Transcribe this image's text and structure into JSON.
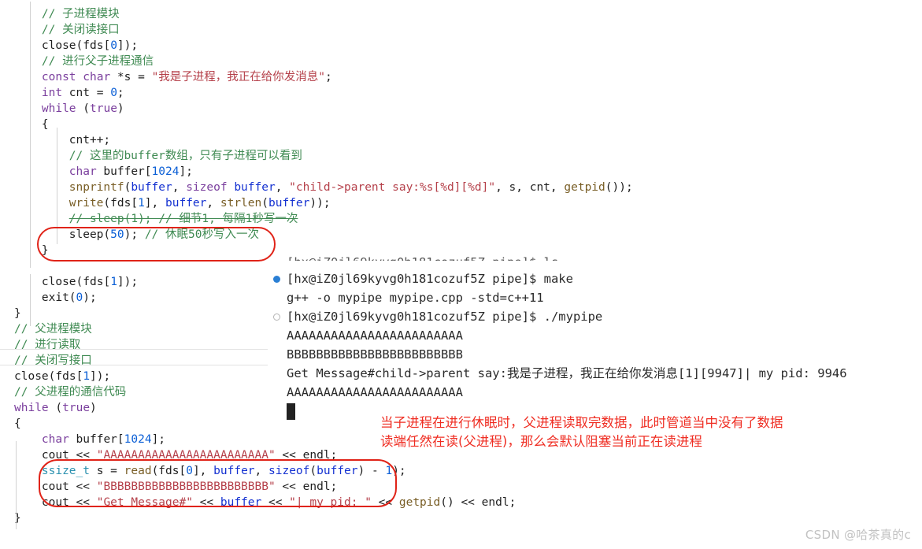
{
  "meta": {
    "watermark": "CSDN @哈茶真的c"
  },
  "colors": {
    "keyword": "#7a3e9d",
    "string": "#b5404a",
    "comment": "#3f8a52",
    "number": "#0b5fd6",
    "function": "#795e26",
    "variable": "#1431d1",
    "type": "#2b91af",
    "annotation_red": "#ef2d22",
    "bullet_active": "#2a7fd4",
    "background": "#ffffff"
  },
  "code": {
    "lines": [
      {
        "indent": 4,
        "tokens": [
          {
            "t": "// 子进程模块",
            "c": "cmt"
          }
        ]
      },
      {
        "indent": 4,
        "tokens": [
          {
            "t": "// 关闭读接口",
            "c": "cmt"
          }
        ]
      },
      {
        "indent": 4,
        "tokens": [
          {
            "t": "close",
            "c": "plain"
          },
          {
            "t": "(fds[",
            "c": "punc"
          },
          {
            "t": "0",
            "c": "num"
          },
          {
            "t": "]);",
            "c": "punc"
          }
        ]
      },
      {
        "indent": 4,
        "tokens": [
          {
            "t": "// 进行父子进程通信",
            "c": "cmt"
          }
        ]
      },
      {
        "indent": 4,
        "tokens": [
          {
            "t": "const",
            "c": "kw"
          },
          {
            "t": " ",
            "c": "plain"
          },
          {
            "t": "char",
            "c": "kw"
          },
          {
            "t": " *s = ",
            "c": "plain"
          },
          {
            "t": "\"我是子进程，我正在给你发消息\"",
            "c": "str"
          },
          {
            "t": ";",
            "c": "punc"
          }
        ]
      },
      {
        "indent": 4,
        "tokens": [
          {
            "t": "int",
            "c": "kw"
          },
          {
            "t": " cnt = ",
            "c": "plain"
          },
          {
            "t": "0",
            "c": "num"
          },
          {
            "t": ";",
            "c": "punc"
          }
        ]
      },
      {
        "indent": 4,
        "tokens": [
          {
            "t": "while",
            "c": "kw"
          },
          {
            "t": " (",
            "c": "punc"
          },
          {
            "t": "true",
            "c": "kw"
          },
          {
            "t": ")",
            "c": "punc"
          }
        ]
      },
      {
        "indent": 4,
        "tokens": [
          {
            "t": "{",
            "c": "punc"
          }
        ]
      },
      {
        "indent": 8,
        "tokens": [
          {
            "t": "cnt++;",
            "c": "plain"
          }
        ]
      },
      {
        "indent": 8,
        "tokens": [
          {
            "t": "// 这里的buffer数组，只有子进程可以看到",
            "c": "cmt"
          }
        ]
      },
      {
        "indent": 8,
        "tokens": [
          {
            "t": "char",
            "c": "kw"
          },
          {
            "t": " buffer[",
            "c": "plain"
          },
          {
            "t": "1024",
            "c": "num"
          },
          {
            "t": "];",
            "c": "punc"
          }
        ]
      },
      {
        "indent": 8,
        "tokens": [
          {
            "t": "snprintf",
            "c": "fn"
          },
          {
            "t": "(",
            "c": "punc"
          },
          {
            "t": "buffer",
            "c": "var"
          },
          {
            "t": ", ",
            "c": "punc"
          },
          {
            "t": "sizeof",
            "c": "kw"
          },
          {
            "t": " ",
            "c": "plain"
          },
          {
            "t": "buffer",
            "c": "var"
          },
          {
            "t": ", ",
            "c": "punc"
          },
          {
            "t": "\"child->parent say:%s[%d][%d]\"",
            "c": "str"
          },
          {
            "t": ", s, cnt, ",
            "c": "punc"
          },
          {
            "t": "getpid",
            "c": "fn"
          },
          {
            "t": "());",
            "c": "punc"
          }
        ]
      },
      {
        "indent": 8,
        "tokens": [
          {
            "t": "write",
            "c": "fn"
          },
          {
            "t": "(fds[",
            "c": "punc"
          },
          {
            "t": "1",
            "c": "num"
          },
          {
            "t": "], ",
            "c": "punc"
          },
          {
            "t": "buffer",
            "c": "var"
          },
          {
            "t": ", ",
            "c": "punc"
          },
          {
            "t": "strlen",
            "c": "fn"
          },
          {
            "t": "(",
            "c": "punc"
          },
          {
            "t": "buffer",
            "c": "var"
          },
          {
            "t": "));",
            "c": "punc"
          }
        ]
      },
      {
        "indent": 8,
        "strike": true,
        "tokens": [
          {
            "t": "// sleep(1); // 细节1, 每隔1秒写一次",
            "c": "cmt"
          }
        ]
      },
      {
        "indent": 8,
        "tokens": [
          {
            "t": "sleep",
            "c": "plain"
          },
          {
            "t": "(",
            "c": "punc"
          },
          {
            "t": "50",
            "c": "num"
          },
          {
            "t": "); ",
            "c": "punc"
          },
          {
            "t": "// 休眠50秒写入一次",
            "c": "cmt"
          }
        ]
      },
      {
        "indent": 4,
        "tokens": [
          {
            "t": "}",
            "c": "punc"
          }
        ]
      },
      {
        "indent": 4,
        "tokens": [
          {
            "t": "",
            "c": "plain"
          }
        ]
      },
      {
        "indent": 4,
        "tokens": [
          {
            "t": "close",
            "c": "plain"
          },
          {
            "t": "(fds[",
            "c": "punc"
          },
          {
            "t": "1",
            "c": "num"
          },
          {
            "t": "]);",
            "c": "punc"
          }
        ]
      },
      {
        "indent": 4,
        "tokens": [
          {
            "t": "exit",
            "c": "plain"
          },
          {
            "t": "(",
            "c": "punc"
          },
          {
            "t": "0",
            "c": "num"
          },
          {
            "t": ");",
            "c": "punc"
          }
        ]
      },
      {
        "indent": 0,
        "tokens": [
          {
            "t": "}",
            "c": "punc"
          }
        ]
      },
      {
        "indent": 0,
        "tokens": [
          {
            "t": "// 父进程模块",
            "c": "cmt"
          }
        ]
      },
      {
        "indent": 0,
        "tokens": [
          {
            "t": "// 进行读取",
            "c": "cmt"
          }
        ]
      },
      {
        "indent": 0,
        "tokens": [
          {
            "t": "// 关闭写接口",
            "c": "cmt"
          }
        ]
      },
      {
        "indent": 0,
        "tokens": [
          {
            "t": "close",
            "c": "plain"
          },
          {
            "t": "(fds[",
            "c": "punc"
          },
          {
            "t": "1",
            "c": "num"
          },
          {
            "t": "]);",
            "c": "punc"
          }
        ]
      },
      {
        "indent": 0,
        "tokens": [
          {
            "t": "// 父进程的通信代码",
            "c": "cmt"
          }
        ]
      },
      {
        "indent": 0,
        "tokens": [
          {
            "t": "while",
            "c": "kw"
          },
          {
            "t": " (",
            "c": "punc"
          },
          {
            "t": "true",
            "c": "kw"
          },
          {
            "t": ")",
            "c": "punc"
          }
        ]
      },
      {
        "indent": 0,
        "tokens": [
          {
            "t": "{",
            "c": "punc"
          }
        ]
      },
      {
        "indent": 4,
        "tokens": [
          {
            "t": "char",
            "c": "kw"
          },
          {
            "t": " buffer[",
            "c": "plain"
          },
          {
            "t": "1024",
            "c": "num"
          },
          {
            "t": "];",
            "c": "punc"
          }
        ]
      },
      {
        "indent": 4,
        "tokens": [
          {
            "t": "cout",
            "c": "plain"
          },
          {
            "t": " << ",
            "c": "punc"
          },
          {
            "t": "\"AAAAAAAAAAAAAAAAAAAAAAAA\"",
            "c": "str"
          },
          {
            "t": " << ",
            "c": "punc"
          },
          {
            "t": "endl",
            "c": "plain"
          },
          {
            "t": ";",
            "c": "punc"
          }
        ]
      },
      {
        "indent": 4,
        "tokens": [
          {
            "t": "ssize_t",
            "c": "type"
          },
          {
            "t": " s = ",
            "c": "plain"
          },
          {
            "t": "read",
            "c": "fn"
          },
          {
            "t": "(fds[",
            "c": "punc"
          },
          {
            "t": "0",
            "c": "num"
          },
          {
            "t": "], ",
            "c": "punc"
          },
          {
            "t": "buffer",
            "c": "var"
          },
          {
            "t": ", ",
            "c": "punc"
          },
          {
            "t": "sizeof",
            "c": "kw2"
          },
          {
            "t": "(",
            "c": "punc"
          },
          {
            "t": "buffer",
            "c": "var"
          },
          {
            "t": ") - ",
            "c": "punc"
          },
          {
            "t": "1",
            "c": "num"
          },
          {
            "t": ");",
            "c": "punc"
          }
        ]
      },
      {
        "indent": 4,
        "tokens": [
          {
            "t": "cout",
            "c": "plain"
          },
          {
            "t": " << ",
            "c": "punc"
          },
          {
            "t": "\"BBBBBBBBBBBBBBBBBBBBBBBB\"",
            "c": "str"
          },
          {
            "t": " << ",
            "c": "punc"
          },
          {
            "t": "endl",
            "c": "plain"
          },
          {
            "t": ";",
            "c": "punc"
          }
        ]
      },
      {
        "indent": 4,
        "tokens": [
          {
            "t": "cout",
            "c": "plain"
          },
          {
            "t": " << ",
            "c": "punc"
          },
          {
            "t": "\"Get Message#\"",
            "c": "str"
          },
          {
            "t": " << ",
            "c": "punc"
          },
          {
            "t": "buffer",
            "c": "var"
          },
          {
            "t": " << ",
            "c": "punc"
          },
          {
            "t": "\"| my pid: \"",
            "c": "str"
          },
          {
            "t": " << ",
            "c": "punc"
          },
          {
            "t": "getpid",
            "c": "fn"
          },
          {
            "t": "() << ",
            "c": "punc"
          },
          {
            "t": "endl",
            "c": "plain"
          },
          {
            "t": ";",
            "c": "punc"
          }
        ]
      },
      {
        "indent": 0,
        "tokens": [
          {
            "t": "}",
            "c": "punc"
          }
        ]
      }
    ]
  },
  "terminal": {
    "lines": [
      {
        "bullet": "filled",
        "text": "[hx@iZ0jl69kyvg0h181cozuf5Z pipe]$ make"
      },
      {
        "bullet": "none",
        "text": "g++ -o mypipe mypipe.cpp -std=c++11"
      },
      {
        "bullet": "hollow",
        "text": "[hx@iZ0jl69kyvg0h181cozuf5Z pipe]$ ./mypipe"
      },
      {
        "bullet": "none",
        "text": "AAAAAAAAAAAAAAAAAAAAAAAA"
      },
      {
        "bullet": "none",
        "text": "BBBBBBBBBBBBBBBBBBBBBBBB"
      },
      {
        "bullet": "none",
        "text": "Get Message#child->parent say:我是子进程，我正在给你发消息[1][9947]| my pid: 9946"
      },
      {
        "bullet": "none",
        "text": "AAAAAAAAAAAAAAAAAAAAAAAA"
      }
    ],
    "prompt_user_host": "hx@iZ0jl69kyvg0h181cozuf5Z",
    "prompt_dir": "pipe",
    "command_make": "make",
    "command_run": "./mypipe",
    "compile_cmd": "g++ -o mypipe mypipe.cpp -std=c++11",
    "child_pid": "9947",
    "parent_pid": "9946",
    "cursor": "▮"
  },
  "annotations": {
    "note_lines": [
      "当子进程在进行休眠时，父进程读取完数据，此时管道当中没有了数据",
      "读端任然在读(父进程)，那么会默认阻塞当前正在读进程"
    ],
    "highlight_sleep_label": "sleep(50)-highlight",
    "highlight_read_label": "cout-read-block-highlight"
  }
}
